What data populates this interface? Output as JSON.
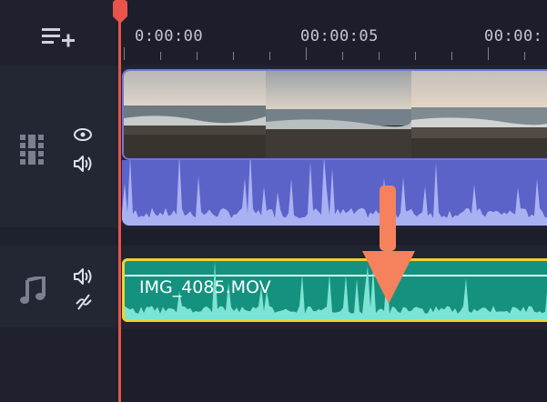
{
  "toolbar": {
    "add_track_icon": "add-track-icon"
  },
  "ruler": {
    "timecodes": [
      "0:00:00",
      "00:00:05",
      "00:00:"
    ]
  },
  "tracks": {
    "video": {
      "icons": [
        "video-track-icon",
        "eye-icon",
        "volume-icon"
      ]
    },
    "audio": {
      "icons": [
        "music-note-icon",
        "volume-icon",
        "link-broken-icon"
      ]
    }
  },
  "audio_clip": {
    "label": "IMG_4085.MOV"
  },
  "colors": {
    "playhead": "#e8544a",
    "video_clip": "#5b63c9",
    "audio_clip": "#15917f",
    "audio_clip_border": "#ead434",
    "arrow": "#f5825d"
  }
}
